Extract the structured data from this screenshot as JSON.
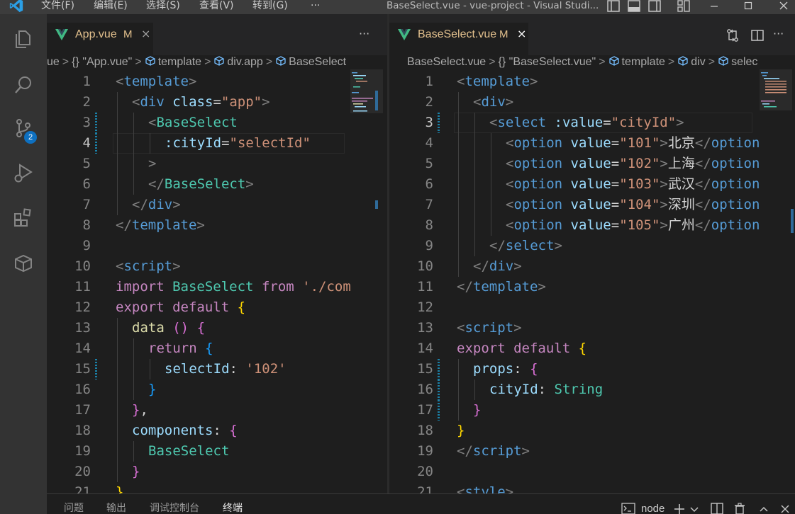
{
  "titlebar": {
    "menu": [
      "文件(F)",
      "编辑(E)",
      "选择(S)",
      "查看(V)",
      "转到(G)",
      "···"
    ],
    "title": "BaseSelect.vue - vue-project - Visual Studi..."
  },
  "activitybar": {
    "icons": [
      "explorer-icon",
      "search-icon",
      "source-control-icon",
      "run-debug-icon",
      "extensions-icon",
      "remote-box-icon"
    ],
    "scm_badge": "2"
  },
  "left_editor": {
    "tab": {
      "name": "App.vue",
      "modified": "M",
      "close": "×"
    },
    "more_actions": "···",
    "breadcrumb": {
      "segments": [
        "ue",
        "{} \"App.vue\"",
        "template",
        "div.app",
        "BaseSelect"
      ]
    },
    "lines": [
      {
        "n": "1",
        "tokens": [
          [
            "t-tag-br",
            "<"
          ],
          [
            "t-tag",
            "template"
          ],
          [
            "t-tag-br",
            ">"
          ]
        ],
        "indent": 0
      },
      {
        "n": "2",
        "tokens": [
          [
            "t-tag-br",
            "<"
          ],
          [
            "t-tag",
            "div"
          ],
          [
            "t-text",
            " "
          ],
          [
            "t-attr",
            "class"
          ],
          [
            "t-text",
            "="
          ],
          [
            "t-str",
            "\"app\""
          ],
          [
            "t-tag-br",
            ">"
          ]
        ],
        "indent": 1
      },
      {
        "n": "3",
        "tokens": [
          [
            "t-tag-br",
            "<"
          ],
          [
            "t-comp",
            "BaseSelect"
          ]
        ],
        "indent": 2
      },
      {
        "n": "4",
        "tokens": [
          [
            "t-attr",
            ":cityId"
          ],
          [
            "t-text",
            "="
          ],
          [
            "t-str",
            "\"selectId\""
          ]
        ],
        "indent": 3
      },
      {
        "n": "5",
        "tokens": [
          [
            "t-tag-br",
            ">"
          ]
        ],
        "indent": 2
      },
      {
        "n": "6",
        "tokens": [
          [
            "t-tag-br",
            "</"
          ],
          [
            "t-comp",
            "BaseSelect"
          ],
          [
            "t-tag-br",
            ">"
          ]
        ],
        "indent": 2
      },
      {
        "n": "7",
        "tokens": [
          [
            "t-tag-br",
            "</"
          ],
          [
            "t-tag",
            "div"
          ],
          [
            "t-tag-br",
            ">"
          ]
        ],
        "indent": 1
      },
      {
        "n": "8",
        "tokens": [
          [
            "t-tag-br",
            "</"
          ],
          [
            "t-tag",
            "template"
          ],
          [
            "t-tag-br",
            ">"
          ]
        ],
        "indent": 0
      },
      {
        "n": "9",
        "tokens": [],
        "indent": 0
      },
      {
        "n": "10",
        "tokens": [
          [
            "t-tag-br",
            "<"
          ],
          [
            "t-tag",
            "script"
          ],
          [
            "t-tag-br",
            ">"
          ]
        ],
        "indent": 0
      },
      {
        "n": "11",
        "tokens": [
          [
            "t-kw",
            "import"
          ],
          [
            "t-text",
            " "
          ],
          [
            "t-comp",
            "BaseSelect"
          ],
          [
            "t-text",
            " "
          ],
          [
            "t-kw",
            "from"
          ],
          [
            "t-text",
            " "
          ],
          [
            "t-str",
            "'./com"
          ]
        ],
        "indent": 0
      },
      {
        "n": "12",
        "tokens": [
          [
            "t-kw",
            "export"
          ],
          [
            "t-text",
            " "
          ],
          [
            "t-kw",
            "default"
          ],
          [
            "t-text",
            " "
          ],
          [
            "t-br1",
            "{"
          ]
        ],
        "indent": 0
      },
      {
        "n": "13",
        "tokens": [
          [
            "t-func",
            "data"
          ],
          [
            "t-text",
            " "
          ],
          [
            "t-br2",
            "()"
          ],
          [
            "t-text",
            " "
          ],
          [
            "t-br2",
            "{"
          ]
        ],
        "indent": 1
      },
      {
        "n": "14",
        "tokens": [
          [
            "t-kw",
            "return"
          ],
          [
            "t-text",
            " "
          ],
          [
            "t-br3",
            "{"
          ]
        ],
        "indent": 2
      },
      {
        "n": "15",
        "tokens": [
          [
            "t-id",
            "selectId"
          ],
          [
            "t-text",
            ": "
          ],
          [
            "t-str",
            "'102'"
          ]
        ],
        "indent": 3
      },
      {
        "n": "16",
        "tokens": [
          [
            "t-br3",
            "}"
          ]
        ],
        "indent": 2
      },
      {
        "n": "17",
        "tokens": [
          [
            "t-br2",
            "}"
          ],
          [
            "t-text",
            ","
          ]
        ],
        "indent": 1
      },
      {
        "n": "18",
        "tokens": [
          [
            "t-id",
            "components"
          ],
          [
            "t-text",
            ": "
          ],
          [
            "t-br2",
            "{"
          ]
        ],
        "indent": 1
      },
      {
        "n": "19",
        "tokens": [
          [
            "t-comp",
            "BaseSelect"
          ]
        ],
        "indent": 2
      },
      {
        "n": "20",
        "tokens": [
          [
            "t-br2",
            "}"
          ]
        ],
        "indent": 1
      },
      {
        "n": "21",
        "tokens": [
          [
            "t-br1",
            "}"
          ]
        ],
        "indent": 0
      }
    ],
    "active_line": "4"
  },
  "right_editor": {
    "tab": {
      "name": "BaseSelect.vue",
      "modified": "M",
      "close": "×"
    },
    "more_actions": "···",
    "breadcrumb": {
      "segments": [
        "BaseSelect.vue",
        "{} \"BaseSelect.vue\"",
        "template",
        "div",
        "selec"
      ]
    },
    "lines": [
      {
        "n": "1",
        "tokens": [
          [
            "t-tag-br",
            "<"
          ],
          [
            "t-tag",
            "template"
          ],
          [
            "t-tag-br",
            ">"
          ]
        ],
        "indent": 0
      },
      {
        "n": "2",
        "tokens": [
          [
            "t-tag-br",
            "<"
          ],
          [
            "t-tag",
            "div"
          ],
          [
            "t-tag-br",
            ">"
          ]
        ],
        "indent": 1
      },
      {
        "n": "3",
        "tokens": [
          [
            "t-tag-br",
            "<"
          ],
          [
            "t-tag",
            "select"
          ],
          [
            "t-text",
            " "
          ],
          [
            "t-attr",
            ":value"
          ],
          [
            "t-text",
            "="
          ],
          [
            "t-str",
            "\"cityId\""
          ],
          [
            "t-tag-br",
            ">"
          ]
        ],
        "indent": 2
      },
      {
        "n": "4",
        "tokens": [
          [
            "t-tag-br",
            "<"
          ],
          [
            "t-tag",
            "option"
          ],
          [
            "t-text",
            " "
          ],
          [
            "t-attr",
            "value"
          ],
          [
            "t-text",
            "="
          ],
          [
            "t-str",
            "\"101\""
          ],
          [
            "t-tag-br",
            ">"
          ],
          [
            "t-text",
            "北京"
          ],
          [
            "t-tag-br",
            "</"
          ],
          [
            "t-tag",
            "option"
          ]
        ],
        "indent": 3
      },
      {
        "n": "5",
        "tokens": [
          [
            "t-tag-br",
            "<"
          ],
          [
            "t-tag",
            "option"
          ],
          [
            "t-text",
            " "
          ],
          [
            "t-attr",
            "value"
          ],
          [
            "t-text",
            "="
          ],
          [
            "t-str",
            "\"102\""
          ],
          [
            "t-tag-br",
            ">"
          ],
          [
            "t-text",
            "上海"
          ],
          [
            "t-tag-br",
            "</"
          ],
          [
            "t-tag",
            "option"
          ]
        ],
        "indent": 3
      },
      {
        "n": "6",
        "tokens": [
          [
            "t-tag-br",
            "<"
          ],
          [
            "t-tag",
            "option"
          ],
          [
            "t-text",
            " "
          ],
          [
            "t-attr",
            "value"
          ],
          [
            "t-text",
            "="
          ],
          [
            "t-str",
            "\"103\""
          ],
          [
            "t-tag-br",
            ">"
          ],
          [
            "t-text",
            "武汉"
          ],
          [
            "t-tag-br",
            "</"
          ],
          [
            "t-tag",
            "option"
          ]
        ],
        "indent": 3
      },
      {
        "n": "7",
        "tokens": [
          [
            "t-tag-br",
            "<"
          ],
          [
            "t-tag",
            "option"
          ],
          [
            "t-text",
            " "
          ],
          [
            "t-attr",
            "value"
          ],
          [
            "t-text",
            "="
          ],
          [
            "t-str",
            "\"104\""
          ],
          [
            "t-tag-br",
            ">"
          ],
          [
            "t-text",
            "深圳"
          ],
          [
            "t-tag-br",
            "</"
          ],
          [
            "t-tag",
            "option"
          ]
        ],
        "indent": 3
      },
      {
        "n": "8",
        "tokens": [
          [
            "t-tag-br",
            "<"
          ],
          [
            "t-tag",
            "option"
          ],
          [
            "t-text",
            " "
          ],
          [
            "t-attr",
            "value"
          ],
          [
            "t-text",
            "="
          ],
          [
            "t-str",
            "\"105\""
          ],
          [
            "t-tag-br",
            ">"
          ],
          [
            "t-text",
            "广州"
          ],
          [
            "t-tag-br",
            "</"
          ],
          [
            "t-tag",
            "option"
          ]
        ],
        "indent": 3
      },
      {
        "n": "9",
        "tokens": [
          [
            "t-tag-br",
            "</"
          ],
          [
            "t-tag",
            "select"
          ],
          [
            "t-tag-br",
            ">"
          ]
        ],
        "indent": 2
      },
      {
        "n": "10",
        "tokens": [
          [
            "t-tag-br",
            "</"
          ],
          [
            "t-tag",
            "div"
          ],
          [
            "t-tag-br",
            ">"
          ]
        ],
        "indent": 1
      },
      {
        "n": "11",
        "tokens": [
          [
            "t-tag-br",
            "</"
          ],
          [
            "t-tag",
            "template"
          ],
          [
            "t-tag-br",
            ">"
          ]
        ],
        "indent": 0
      },
      {
        "n": "12",
        "tokens": [],
        "indent": 0
      },
      {
        "n": "13",
        "tokens": [
          [
            "t-tag-br",
            "<"
          ],
          [
            "t-tag",
            "script"
          ],
          [
            "t-tag-br",
            ">"
          ]
        ],
        "indent": 0
      },
      {
        "n": "14",
        "tokens": [
          [
            "t-kw",
            "export"
          ],
          [
            "t-text",
            " "
          ],
          [
            "t-kw",
            "default"
          ],
          [
            "t-text",
            " "
          ],
          [
            "t-br1",
            "{"
          ]
        ],
        "indent": 0
      },
      {
        "n": "15",
        "tokens": [
          [
            "t-id",
            "props"
          ],
          [
            "t-text",
            ": "
          ],
          [
            "t-br2",
            "{"
          ]
        ],
        "indent": 1
      },
      {
        "n": "16",
        "tokens": [
          [
            "t-id",
            "cityId"
          ],
          [
            "t-text",
            ": "
          ],
          [
            "t-comp",
            "String"
          ]
        ],
        "indent": 2
      },
      {
        "n": "17",
        "tokens": [
          [
            "t-br2",
            "}"
          ]
        ],
        "indent": 1
      },
      {
        "n": "18",
        "tokens": [
          [
            "t-br1",
            "}"
          ]
        ],
        "indent": 0
      },
      {
        "n": "19",
        "tokens": [
          [
            "t-tag-br",
            "</"
          ],
          [
            "t-tag",
            "script"
          ],
          [
            "t-tag-br",
            ">"
          ]
        ],
        "indent": 0
      },
      {
        "n": "20",
        "tokens": [],
        "indent": 0
      },
      {
        "n": "21",
        "tokens": [
          [
            "t-tag-br",
            "<"
          ],
          [
            "t-tag",
            "style"
          ],
          [
            "t-tag-br",
            ">"
          ]
        ],
        "indent": 0
      }
    ],
    "active_line": "3"
  },
  "panel": {
    "tabs": [
      "问题",
      "输出",
      "调试控制台",
      "终端"
    ],
    "active_tab": "终端",
    "terminal_name": "node",
    "actions": [
      "terminal-icon",
      "add-terminal-icon",
      "chevron-down-icon",
      "split-terminal-icon",
      "trash-icon",
      "chevron-up-icon",
      "close-icon"
    ]
  },
  "colors": {
    "accent": "#0e70c0",
    "modified": "#e2c08d",
    "vue_green": "#41b883"
  }
}
